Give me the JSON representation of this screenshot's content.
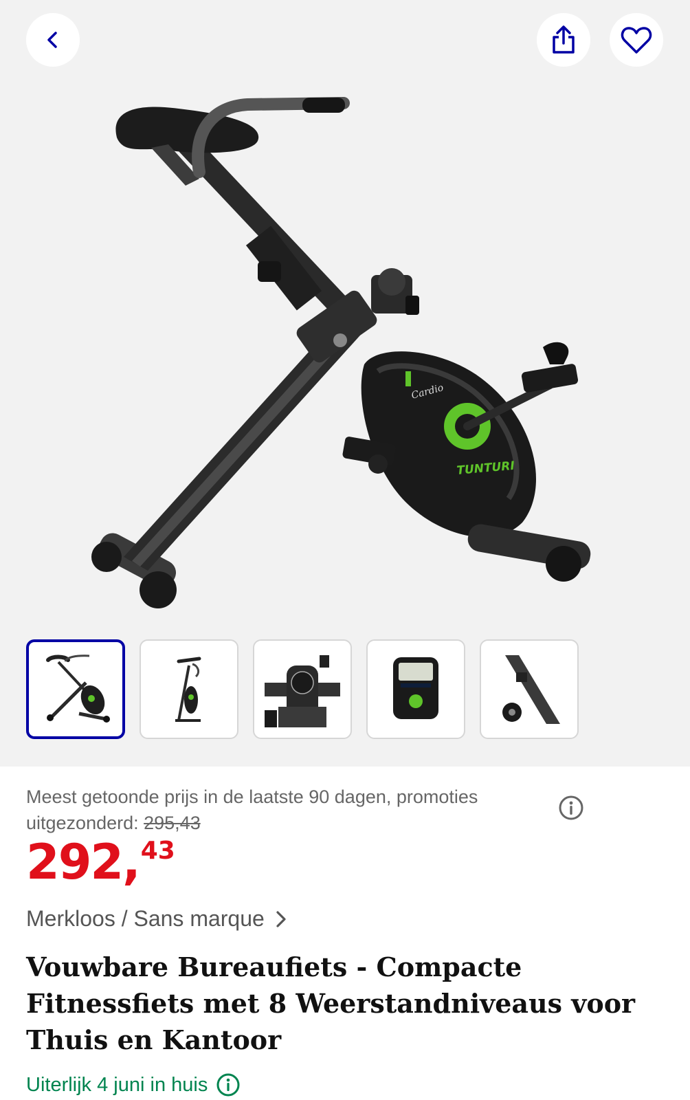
{
  "header": {
    "back_icon": "chevron-left-icon",
    "share_icon": "share-icon",
    "favorite_icon": "heart-icon"
  },
  "gallery": {
    "main_image": {
      "description_icon": "product-image",
      "console_brand_text": "TUNTURI",
      "console_model_text": "Cardio"
    },
    "thumbnails": [
      {
        "name": "thumbnail-bike-side",
        "active": true
      },
      {
        "name": "thumbnail-bike-front",
        "active": false
      },
      {
        "name": "thumbnail-bike-console-back",
        "active": false
      },
      {
        "name": "thumbnail-console-display",
        "active": false
      },
      {
        "name": "thumbnail-frame-knob",
        "active": false
      }
    ]
  },
  "pricing": {
    "note_text": "Meest getoonde prijs in de laatste 90 dagen, promoties uitgezonderd: ",
    "old_price": "295,43",
    "price_main": "292,",
    "price_cents": "43",
    "info_icon": "info-icon"
  },
  "product": {
    "brand": "Merkloos / Sans marque",
    "title": "Vouwbare Bureaufiets - Compacte Fitnessfiets met 8 Weerstandniveaus voor Thuis en Kantoor",
    "delivery": "Uiterlijk 4 juni in huis"
  },
  "colors": {
    "price_red": "#e0101b",
    "delivery_green": "#00844f",
    "accent_blue": "#0000a4",
    "bike_green": "#5fc42a"
  }
}
